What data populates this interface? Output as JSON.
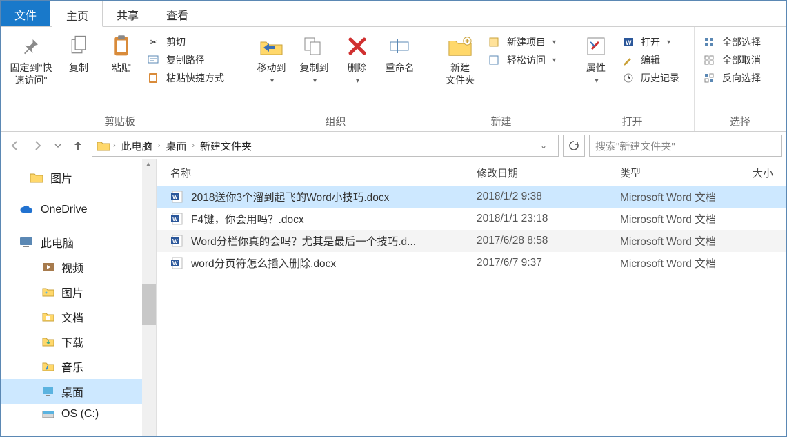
{
  "tabs": {
    "file": "文件",
    "home": "主页",
    "share": "共享",
    "view": "查看"
  },
  "ribbon": {
    "clipboard": {
      "pin": "固定到\"快\n速访问\"",
      "copy": "复制",
      "paste": "粘贴",
      "cut": "剪切",
      "copypath": "复制路径",
      "pasteshortcut": "粘贴快捷方式",
      "label": "剪贴板"
    },
    "organize": {
      "moveto": "移动到",
      "copyto": "复制到",
      "del": "删除",
      "rename": "重命名",
      "label": "组织"
    },
    "new_": {
      "folder": "新建\n文件夹",
      "item": "新建项目",
      "easy": "轻松访问",
      "label": "新建"
    },
    "open": {
      "props": "属性",
      "open": "打开",
      "edit": "编辑",
      "history": "历史记录",
      "label": "打开"
    },
    "select": {
      "all": "全部选择",
      "none": "全部取消",
      "invert": "反向选择",
      "label": "选择"
    }
  },
  "breadcrumbs": [
    "此电脑",
    "桌面",
    "新建文件夹"
  ],
  "search_placeholder": "搜索\"新建文件夹\"",
  "tree": {
    "pictures": "图片",
    "onedrive": "OneDrive",
    "thispc": "此电脑",
    "videos": "视频",
    "pictures2": "图片",
    "docs": "文档",
    "downloads": "下载",
    "music": "音乐",
    "desktop": "桌面",
    "osc": "OS (C:)"
  },
  "columns": {
    "name": "名称",
    "date": "修改日期",
    "type": "类型",
    "size": "大小"
  },
  "files": [
    {
      "name": "2018送你3个溜到起飞的Word小技巧.docx",
      "date": "2018/1/2 9:38",
      "type": "Microsoft Word 文档"
    },
    {
      "name": "F4键，你会用吗？.docx",
      "date": "2018/1/1 23:18",
      "type": "Microsoft Word 文档"
    },
    {
      "name": "Word分栏你真的会吗？尤其是最后一个技巧.d...",
      "date": "2017/6/28 8:58",
      "type": "Microsoft Word 文档"
    },
    {
      "name": "word分页符怎么插入删除.docx",
      "date": "2017/6/7 9:37",
      "type": "Microsoft Word 文档"
    }
  ]
}
